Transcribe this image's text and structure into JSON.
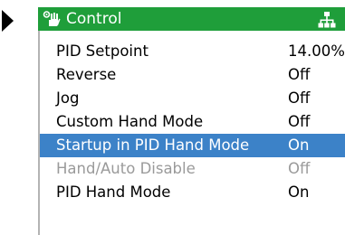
{
  "header": {
    "title": "Control",
    "icon": "hand-control-icon",
    "right_icon": "hierarchy-tree-icon",
    "color": "#1f9e3a"
  },
  "colors": {
    "selected": "#3c82c8",
    "disabled": "#9a9a9a"
  },
  "items": [
    {
      "label": "PID Setpoint",
      "value": "14.00%",
      "state": "normal"
    },
    {
      "label": "Reverse",
      "value": "Off",
      "state": "normal"
    },
    {
      "label": "Jog",
      "value": "Off",
      "state": "normal"
    },
    {
      "label": "Custom Hand Mode",
      "value": "Off",
      "state": "normal"
    },
    {
      "label": "Startup in PID Hand Mode",
      "value": "On",
      "state": "selected"
    },
    {
      "label": "Hand/Auto Disable",
      "value": "Off",
      "state": "disabled"
    },
    {
      "label": "PID Hand Mode",
      "value": "On",
      "state": "normal"
    }
  ]
}
